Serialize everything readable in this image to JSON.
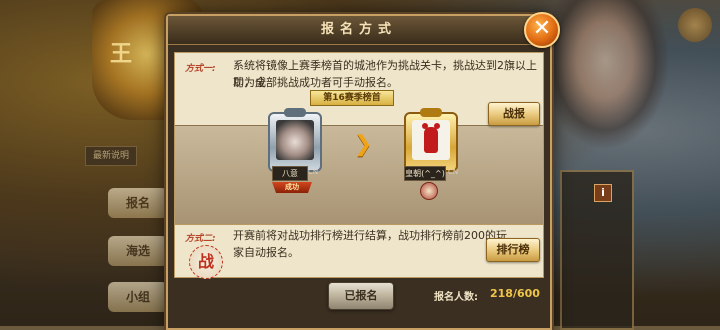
{
  "background": {
    "emblem_text": "王",
    "tag_label": "最新说明",
    "buttons": [
      "报名",
      "海选",
      "小组"
    ]
  },
  "dialog": {
    "title": "报名方式",
    "close_icon": "x-close-icon"
  },
  "method1": {
    "label": "方式一:",
    "description_line1": "系统将镜像上赛季榜首的城池作为挑战关卡，挑战达到2旗以上即为成",
    "description_line2": "功，全部挑战成功者可手动报名。",
    "banner": "第16赛季榜首",
    "battle_report_button": "战报",
    "left_player": {
      "name": "八意",
      "server": "CN",
      "status": "成功"
    },
    "right_player": {
      "name": "皇朝(^_^)",
      "server": "CN"
    }
  },
  "method2": {
    "label": "方式二:",
    "description_line1": "开赛前将对战功排行榜进行结算，战功排行榜前200的玩",
    "description_line2": "家自动报名。",
    "seal_text": "战",
    "ranking_button": "排行榜"
  },
  "footer": {
    "registered_button": "已报名",
    "count_label": "报名人数:",
    "count_value": "218/600"
  },
  "colors": {
    "accent_orange": "#e06a12",
    "gold": "#f0c64a",
    "parchment": "#efe5cb"
  }
}
